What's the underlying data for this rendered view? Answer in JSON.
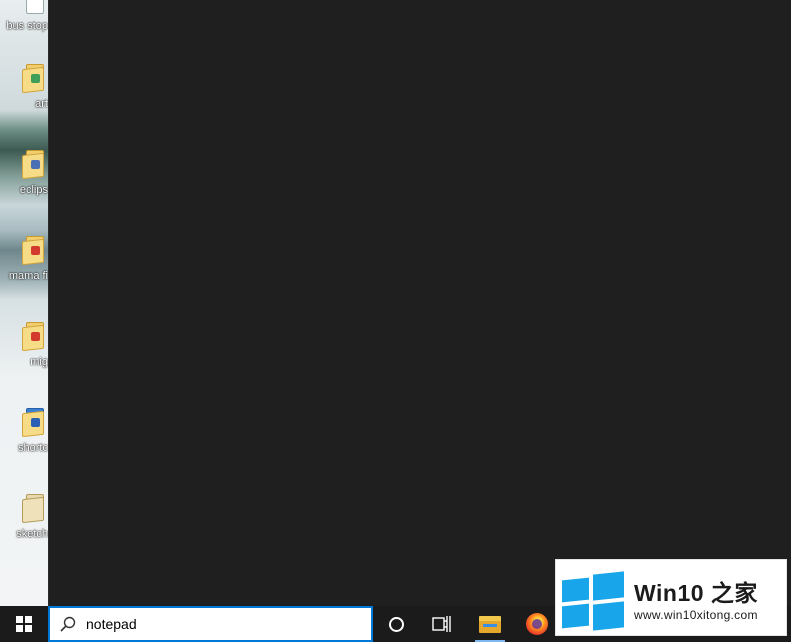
{
  "desktop": {
    "icons": [
      {
        "label": "bus stop"
      },
      {
        "label": "art"
      },
      {
        "label": "eclips"
      },
      {
        "label": "mama fi"
      },
      {
        "label": "mig"
      },
      {
        "label": "shortc"
      },
      {
        "label": "sketch"
      }
    ]
  },
  "taskbar": {
    "start_icon": "windows-logo-icon",
    "search": {
      "icon": "search-icon",
      "value": "notepad"
    },
    "buttons": [
      {
        "name": "cortana",
        "icon": "circle-icon"
      },
      {
        "name": "task-view",
        "icon": "task-view-icon"
      },
      {
        "name": "file-explorer",
        "icon": "folder-icon"
      },
      {
        "name": "firefox",
        "icon": "firefox-icon"
      }
    ],
    "accent": "#0078d7"
  },
  "panel": {
    "background": "#1f1f1f"
  },
  "watermark": {
    "title": "Win10 之家",
    "url": "www.win10xitong.com",
    "logo_color": "#18a5e9"
  }
}
